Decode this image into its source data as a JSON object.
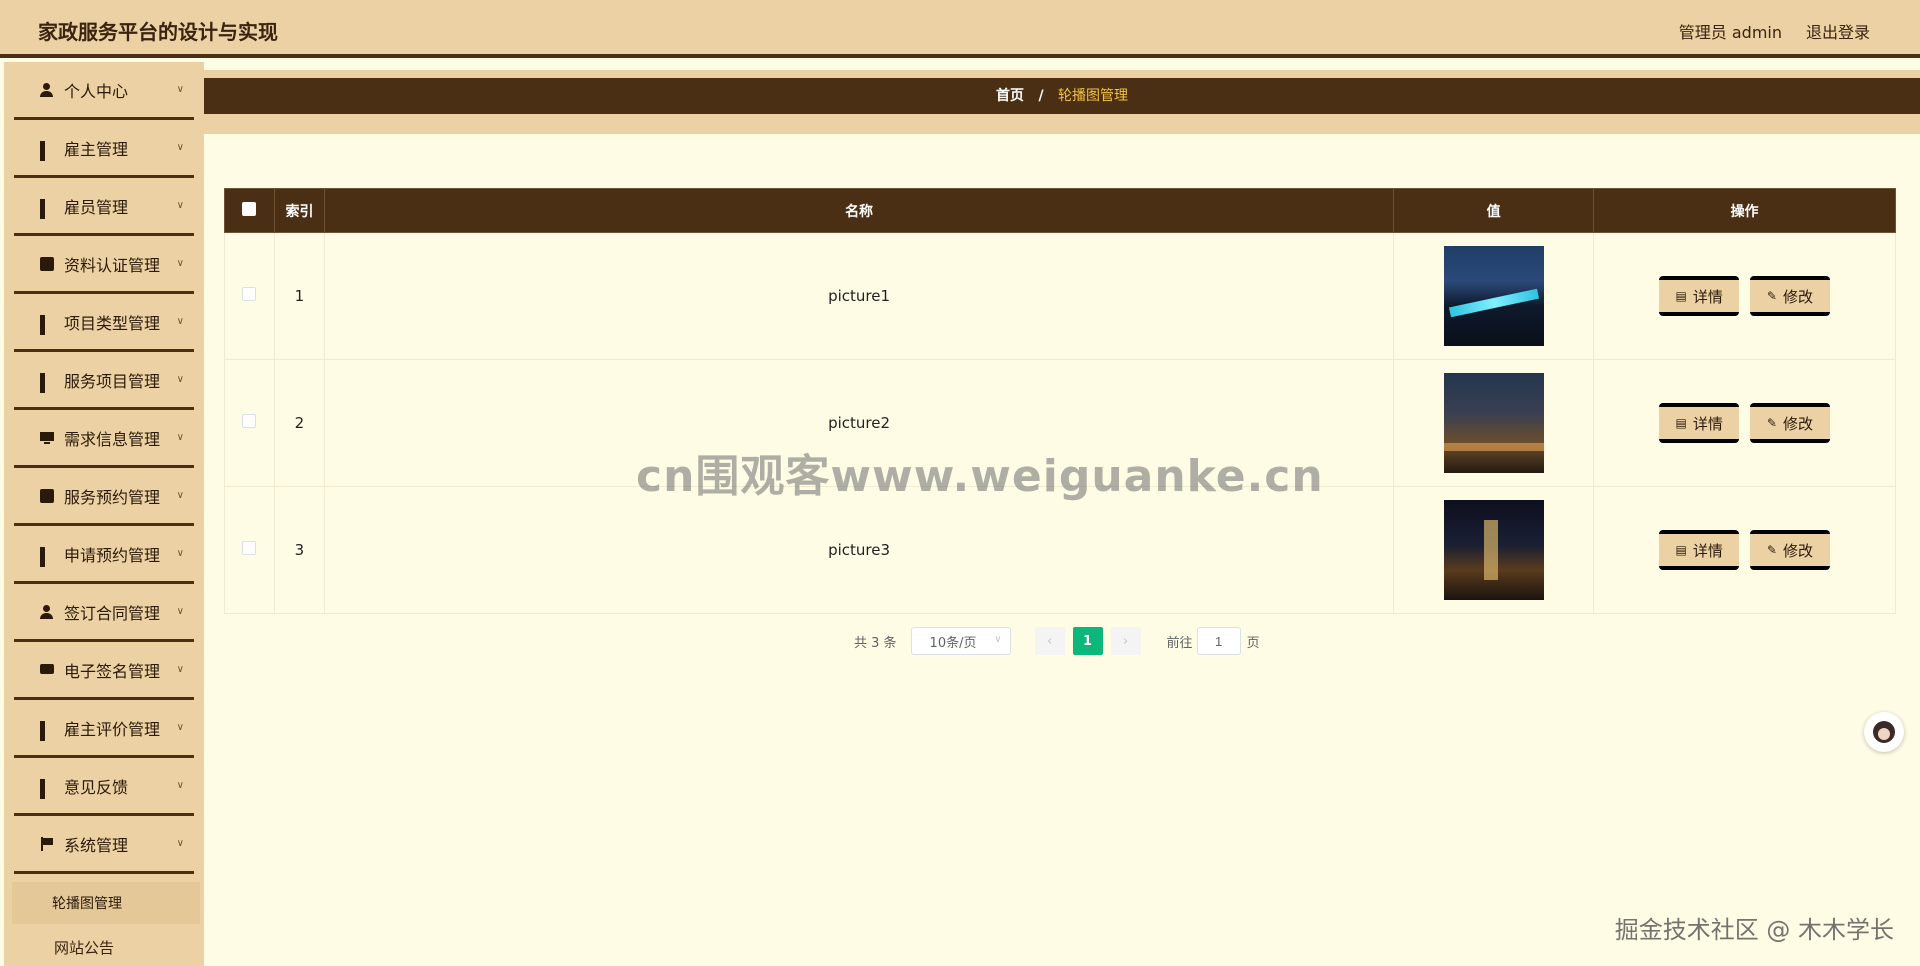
{
  "header": {
    "title": "家政服务平台的设计与实现",
    "admin_label": "管理员 admin",
    "logout_label": "退出登录"
  },
  "sidebar": {
    "items": [
      {
        "label": "个人中心",
        "icon": "person-icon"
      },
      {
        "label": "雇主管理",
        "icon": "grid-icon"
      },
      {
        "label": "雇员管理",
        "icon": "grid-icon"
      },
      {
        "label": "资料认证管理",
        "icon": "wallet-icon"
      },
      {
        "label": "项目类型管理",
        "icon": "grid-icon"
      },
      {
        "label": "服务项目管理",
        "icon": "grid-icon"
      },
      {
        "label": "需求信息管理",
        "icon": "monitor-icon"
      },
      {
        "label": "服务预约管理",
        "icon": "clipboard-icon"
      },
      {
        "label": "申请预约管理",
        "icon": "grid-icon"
      },
      {
        "label": "签订合同管理",
        "icon": "person-icon"
      },
      {
        "label": "电子签名管理",
        "icon": "chat-icon"
      },
      {
        "label": "雇主评价管理",
        "icon": "grid-icon"
      },
      {
        "label": "意见反馈",
        "icon": "grid-icon"
      },
      {
        "label": "系统管理",
        "icon": "flag-icon"
      }
    ],
    "sub_items": [
      {
        "label": "轮播图管理",
        "active": true
      },
      {
        "label": "网站公告",
        "active": false
      }
    ]
  },
  "breadcrumb": {
    "home": "首页",
    "separator": "/",
    "current": "轮播图管理"
  },
  "table": {
    "headers": [
      "索引",
      "名称",
      "值",
      "操作"
    ],
    "rows": [
      {
        "index": "1",
        "name": "picture1",
        "image": "night-bridge-photo"
      },
      {
        "index": "2",
        "name": "picture2",
        "image": "night-canal-buildings-photo"
      },
      {
        "index": "3",
        "name": "picture3",
        "image": "night-skyline-photo"
      }
    ],
    "detail_label": "详情",
    "edit_label": "修改"
  },
  "pagination": {
    "total": "共 3 条",
    "page_size": "10条/页",
    "current_page": "1",
    "goto_label": "前往",
    "goto_value": "1",
    "page_suffix": "页"
  },
  "watermark": "cn围观客www.weiguanke.cn",
  "credit": "掘金技术社区 @ 木木学长",
  "colors": {
    "header_bg": "#ebd1a3",
    "dark_brown": "#4a2f14",
    "page_bg": "#fffce6",
    "active_page": "#0bb87a",
    "crumb_current": "#f5c242"
  }
}
